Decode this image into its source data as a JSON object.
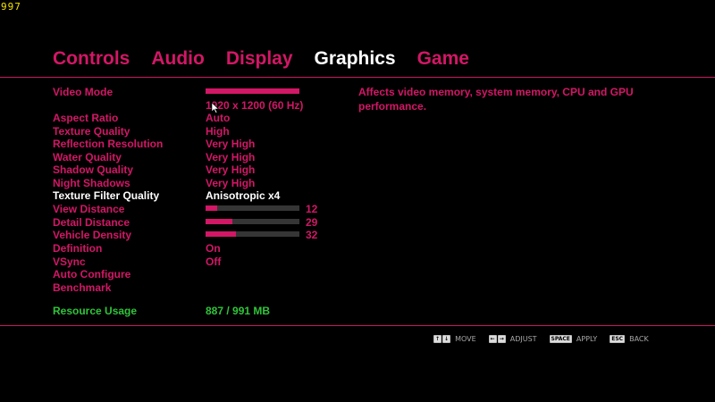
{
  "fps_counter": "997",
  "colors": {
    "accent": "#d21766",
    "active": "#ffffff",
    "green": "#2fc43a",
    "text_pink": "#d21766"
  },
  "tabs": [
    {
      "label": "Controls",
      "active": false
    },
    {
      "label": "Audio",
      "active": false
    },
    {
      "label": "Display",
      "active": false
    },
    {
      "label": "Graphics",
      "active": true
    },
    {
      "label": "Game",
      "active": false
    }
  ],
  "settings": {
    "video_mode": {
      "label": "Video Mode",
      "value": "1920 x 1200 (60 Hz)",
      "slider_level": 1.0
    },
    "aspect_ratio": {
      "label": "Aspect Ratio",
      "value": "Auto"
    },
    "texture_quality": {
      "label": "Texture Quality",
      "value": "High"
    },
    "reflection_resolution": {
      "label": "Reflection Resolution",
      "value": "Very High"
    },
    "water_quality": {
      "label": "Water Quality",
      "value": "Very High"
    },
    "shadow_quality": {
      "label": "Shadow Quality",
      "value": "Very High"
    },
    "night_shadows": {
      "label": "Night Shadows",
      "value": "Very High"
    },
    "texture_filter_quality": {
      "label": "Texture Filter Quality",
      "value": "Anisotropic x4",
      "selected": true
    },
    "view_distance": {
      "label": "View Distance",
      "value": "12",
      "level": 0.12
    },
    "detail_distance": {
      "label": "Detail Distance",
      "value": "29",
      "level": 0.29
    },
    "vehicle_density": {
      "label": "Vehicle Density",
      "value": "32",
      "level": 0.32
    },
    "definition": {
      "label": "Definition",
      "value": "On"
    },
    "vsync": {
      "label": "VSync",
      "value": "Off"
    },
    "auto_configure": {
      "label": "Auto Configure"
    },
    "benchmark": {
      "label": "Benchmark"
    }
  },
  "resource_usage": {
    "label": "Resource Usage",
    "value": "887 / 991 MB"
  },
  "description": "Affects video memory, system memory, CPU and GPU performance.",
  "hints": [
    {
      "keys": [
        "↑",
        "↓"
      ],
      "action": "MOVE"
    },
    {
      "keys": [
        "←",
        "→"
      ],
      "action": "ADJUST"
    },
    {
      "keys": [
        "SPACE"
      ],
      "action": "APPLY"
    },
    {
      "keys": [
        "ESC"
      ],
      "action": "BACK"
    }
  ]
}
